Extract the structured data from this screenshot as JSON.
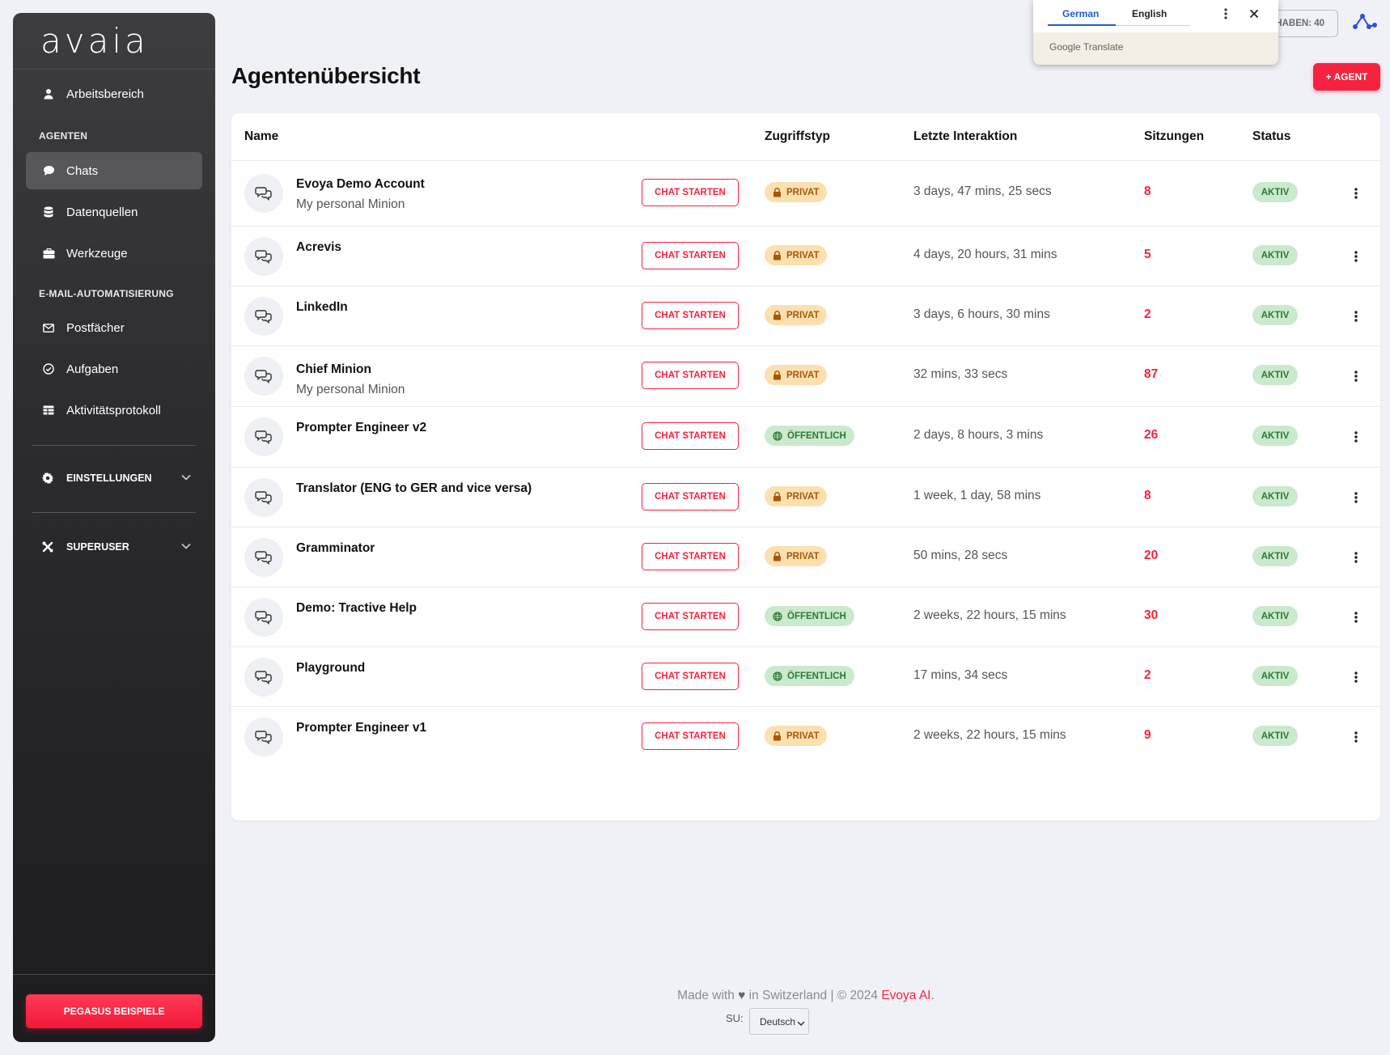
{
  "sidebar": {
    "logo": "avaia",
    "workspace": "Arbeitsbereich",
    "section_agents": "AGENTEN",
    "items_agents": [
      {
        "label": "Chats",
        "icon": "chat-bubble-icon",
        "active": true
      },
      {
        "label": "Datenquellen",
        "icon": "database-icon",
        "active": false
      },
      {
        "label": "Werkzeuge",
        "icon": "toolbox-icon",
        "active": false
      }
    ],
    "section_email": "E-MAIL-AUTOMATISIERUNG",
    "items_email": [
      {
        "label": "Postfächer",
        "icon": "envelope-icon"
      },
      {
        "label": "Aufgaben",
        "icon": "check-circle-icon"
      },
      {
        "label": "Aktivitätsprotokoll",
        "icon": "table-icon"
      }
    ],
    "settings": "EINSTELLUNGEN",
    "superuser": "SUPERUSER",
    "bottom_button": "PEGASUS BEISPIELE"
  },
  "header": {
    "title": "Agentenübersicht",
    "add_button": "+ AGENT",
    "token_chip": "HABEN: 40"
  },
  "translate_popup": {
    "tab_german": "German",
    "tab_english": "English",
    "brand_google": "Google",
    "brand_translate": "Translate"
  },
  "table": {
    "columns": [
      "Name",
      "Zugriffstyp",
      "Letzte Interaktion",
      "Sitzungen",
      "Status"
    ],
    "chat_button_label": "CHAT STARTEN",
    "rows": [
      {
        "name": "Evoya Demo Account",
        "desc": "My personal Minion",
        "access": "PRIVAT",
        "last": "3 days, 47 mins, 25 secs",
        "sessions": "8",
        "status": "AKTIV"
      },
      {
        "name": "Acrevis",
        "desc": "",
        "access": "PRIVAT",
        "last": "4 days, 20 hours, 31 mins",
        "sessions": "5",
        "status": "AKTIV"
      },
      {
        "name": "LinkedIn",
        "desc": "",
        "access": "PRIVAT",
        "last": "3 days, 6 hours, 30 mins",
        "sessions": "2",
        "status": "AKTIV"
      },
      {
        "name": "Chief Minion",
        "desc": "My personal Minion",
        "access": "PRIVAT",
        "last": "32 mins, 33 secs",
        "sessions": "87",
        "status": "AKTIV"
      },
      {
        "name": "Prompter Engineer v2",
        "desc": "",
        "access": "ÖFFENTLICH",
        "last": "2 days, 8 hours, 3 mins",
        "sessions": "26",
        "status": "AKTIV"
      },
      {
        "name": "Translator (ENG to GER and vice versa)",
        "desc": "",
        "access": "PRIVAT",
        "last": "1 week, 1 day, 58 mins",
        "sessions": "8",
        "status": "AKTIV"
      },
      {
        "name": "Gramminator",
        "desc": "",
        "access": "PRIVAT",
        "last": "50 mins, 28 secs",
        "sessions": "20",
        "status": "AKTIV"
      },
      {
        "name": "Demo: Tractive Help",
        "desc": "",
        "access": "ÖFFENTLICH",
        "last": "2 weeks, 22 hours, 15 mins",
        "sessions": "30",
        "status": "AKTIV"
      },
      {
        "name": "Playground",
        "desc": "",
        "access": "ÖFFENTLICH",
        "last": "17 mins, 34 secs",
        "sessions": "2",
        "status": "AKTIV"
      },
      {
        "name": "Prompter Engineer v1",
        "desc": "",
        "access": "PRIVAT",
        "last": "2 weeks, 22 hours, 15 mins",
        "sessions": "9",
        "status": "AKTIV"
      }
    ]
  },
  "footer": {
    "made_with": "Made with",
    "in_switzerland": "in Switzerland | © 2024",
    "brand": "Evoya AI",
    "period": ".",
    "su_label": "SU:",
    "language": "Deutsch"
  },
  "colors": {
    "accent": "#f5233f",
    "private_bg": "#fde0b0",
    "public_bg": "#cbe9cd",
    "sidebar_top": "#3d3d40",
    "sidebar_bottom": "#1c1c1e"
  }
}
